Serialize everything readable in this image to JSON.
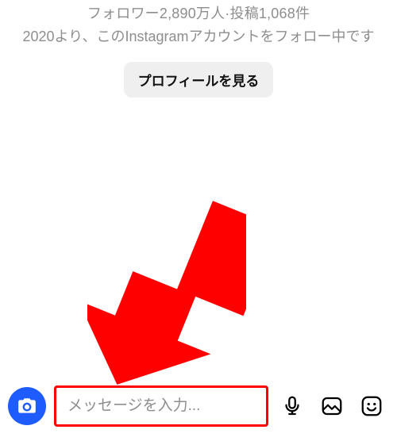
{
  "profile": {
    "stats_line": "フォロワー2,890万人·投稿1,068件",
    "since_line": "2020より、このInstagramアカウントをフォロー中です",
    "view_profile_label": "プロフィールを見る"
  },
  "composer": {
    "placeholder": "メッセージを入力...",
    "value": ""
  },
  "icons": {
    "camera": "camera-icon",
    "mic": "mic-icon",
    "gallery": "gallery-icon",
    "sticker": "sticker-icon"
  },
  "annotation": {
    "arrow_color": "#ff0000",
    "highlight_color": "#ff0000"
  }
}
